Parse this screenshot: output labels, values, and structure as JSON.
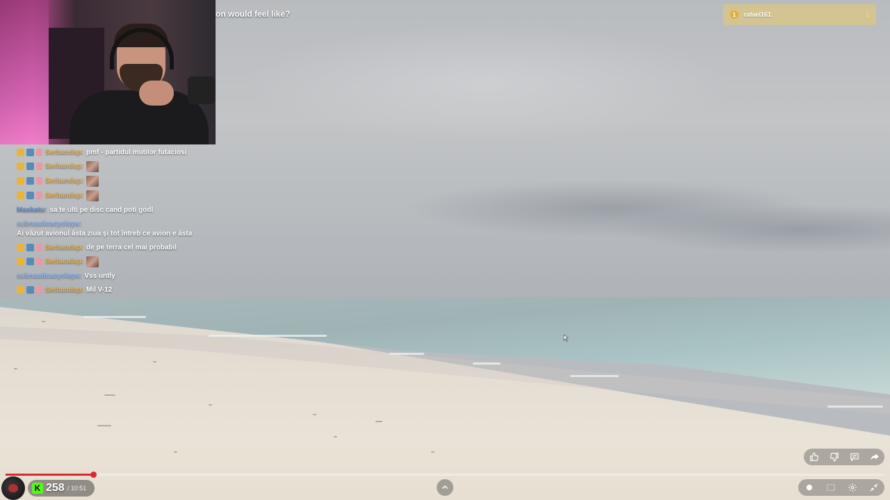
{
  "stream": {
    "question_fragment": "on would feel like?"
  },
  "top_subscriber": {
    "rank": "1",
    "name": "rafael161",
    "count": "1"
  },
  "chat": {
    "messages": [
      {
        "user": "Serbandsp:",
        "text": "pmf - partidul mutilor futaciosi"
      },
      {
        "user": "Serbandsp:",
        "text": ""
      },
      {
        "user": "Serbandsp:",
        "text": ""
      },
      {
        "user": "Serbandsp:",
        "text": ""
      },
      {
        "user": "Maskatu:",
        "text": "sa te ulti pe disc cand poti godl"
      },
      {
        "user": "subnauticacyclops:",
        "text": "Ai văzut avionul ăsta ziua și tot întreb ce avion e ăsta"
      },
      {
        "user": "Serbandsp:",
        "text": "de pe terra cel mai probabil"
      },
      {
        "user": "Serbandsp:",
        "text": ""
      },
      {
        "user": "subnauticacyclops:",
        "text": "Vss untly"
      },
      {
        "user": "Serbandsp:",
        "text": "Mil V-12"
      }
    ]
  },
  "player": {
    "viewers": "258",
    "duration": "/ 10:51",
    "progress_fraction": 0.1
  },
  "icons": {
    "like": "thumbs-up-icon",
    "dislike": "thumbs-down-icon",
    "comment": "comment-icon",
    "share": "share-icon",
    "chevron": "chevron-up-icon",
    "kick": "kick-logo-icon",
    "settings": "gear-icon",
    "exit_fullscreen": "exit-fullscreen-icon"
  },
  "colors": {
    "progress": "#e0262e",
    "kick_green": "#53fc18",
    "gold_user": "#e8b24a",
    "blue_user": "#5f8ed0"
  }
}
